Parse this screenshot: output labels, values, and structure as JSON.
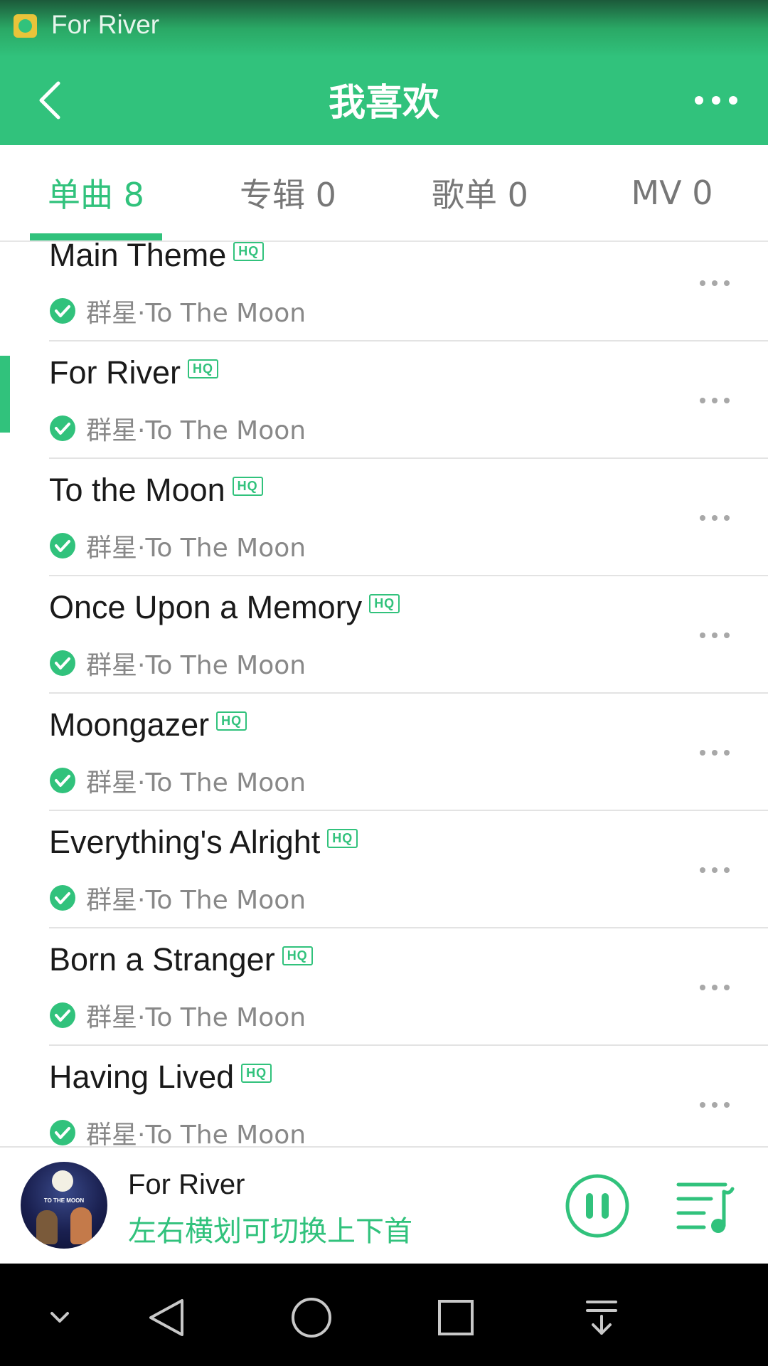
{
  "status_bar": {
    "title": "For River",
    "icon": "qq-music-app-icon"
  },
  "header": {
    "title": "我喜欢",
    "back_icon": "chevron-left-icon",
    "more_icon": "more-horizontal-icon"
  },
  "tabs": [
    {
      "label": "单曲 8",
      "active": true
    },
    {
      "label": "专辑 0",
      "active": false
    },
    {
      "label": "歌单 0",
      "active": false
    },
    {
      "label": "MV 0",
      "active": false
    }
  ],
  "songs": [
    {
      "title": "Main Theme",
      "badge": "HQ",
      "artist": "群星·To The Moon",
      "playing": false
    },
    {
      "title": "For River",
      "badge": "HQ",
      "artist": "群星·To The Moon",
      "playing": true
    },
    {
      "title": "To the Moon",
      "badge": "HQ",
      "artist": "群星·To The Moon",
      "playing": false
    },
    {
      "title": "Once Upon a Memory",
      "badge": "HQ",
      "artist": "群星·To The Moon",
      "playing": false
    },
    {
      "title": "Moongazer",
      "badge": "HQ",
      "artist": "群星·To The Moon",
      "playing": false
    },
    {
      "title": "Everything's Alright",
      "badge": "HQ",
      "artist": "群星·To The Moon",
      "playing": false
    },
    {
      "title": "Born a Stranger",
      "badge": "HQ",
      "artist": "群星·To The Moon",
      "playing": false
    },
    {
      "title": "Having Lived",
      "badge": "HQ",
      "artist": "群星·To The Moon",
      "playing": false
    }
  ],
  "mini_player": {
    "title": "For River",
    "hint": "左右横划可切换上下首",
    "cover_text": "TO THE MOON",
    "pause_icon": "pause-icon",
    "playlist_icon": "playlist-icon"
  },
  "system_nav": [
    "chevron-down-icon",
    "back-triangle-icon",
    "home-circle-icon",
    "recents-square-icon",
    "notification-pulldown-icon"
  ],
  "colors": {
    "accent": "#31c27c",
    "text": "#1a1a1a",
    "muted": "#888888"
  }
}
